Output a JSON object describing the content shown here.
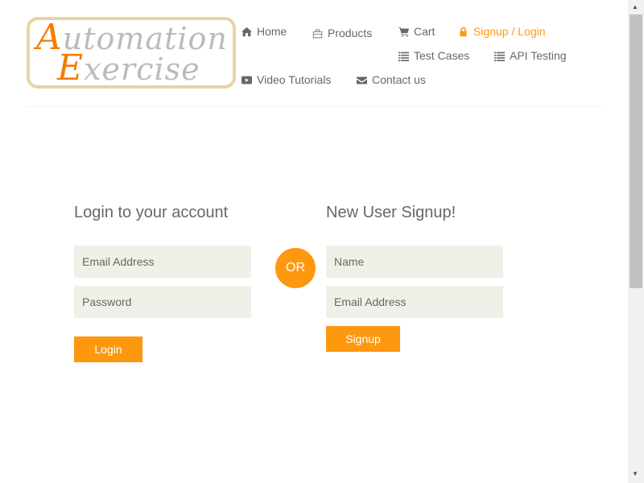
{
  "logo": {
    "line1_first": "A",
    "line1_rest": "utomation",
    "line2_first": "E",
    "line2_rest": "xercise"
  },
  "nav": [
    {
      "label": "Home",
      "icon": "home-icon"
    },
    {
      "label": "Products",
      "icon": "briefcase-icon"
    },
    {
      "label": "Cart",
      "icon": "cart-icon"
    },
    {
      "label": "Signup / Login",
      "icon": "lock-icon",
      "active": true
    },
    {
      "label": "Test Cases",
      "icon": "list-icon"
    },
    {
      "label": "API Testing",
      "icon": "list-icon"
    },
    {
      "label": "Video Tutorials",
      "icon": "youtube-icon"
    },
    {
      "label": "Contact us",
      "icon": "envelope-icon"
    }
  ],
  "login": {
    "title": "Login to your account",
    "email_placeholder": "Email Address",
    "password_placeholder": "Password",
    "button": "Login"
  },
  "or_label": "OR",
  "signup": {
    "title": "New User Signup!",
    "name_placeholder": "Name",
    "email_placeholder": "Email Address",
    "button": "Signup"
  },
  "colors": {
    "accent": "#fe980f",
    "input_bg": "#f0f0e9",
    "text": "#696763"
  }
}
